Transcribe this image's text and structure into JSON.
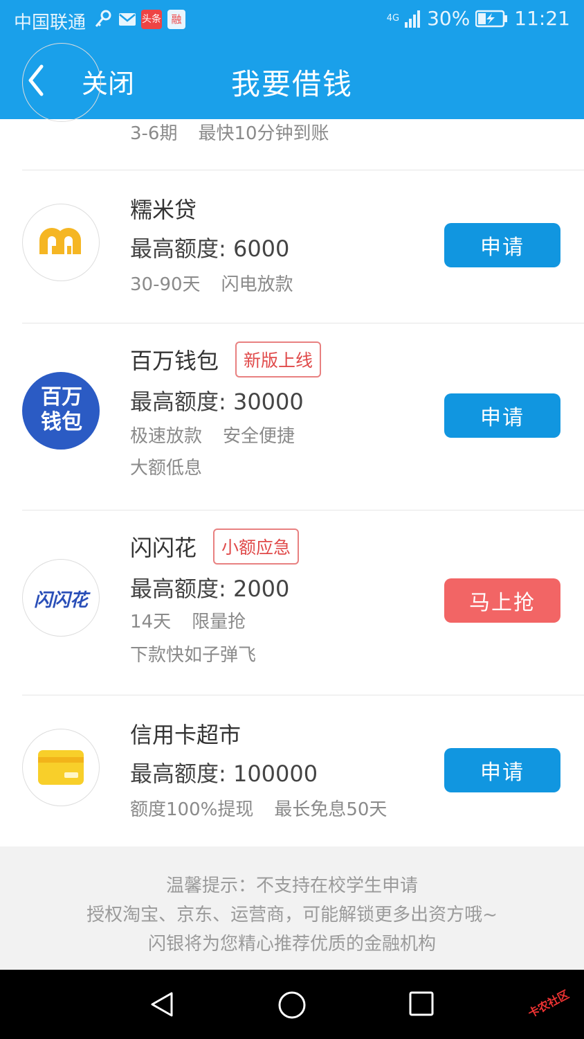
{
  "status_bar": {
    "carrier": "中国联通",
    "network": "4G",
    "battery": "30%",
    "time": "11:21",
    "icons": [
      "key-icon",
      "mail-icon",
      "toutiao-app-icon",
      "rong-app-icon",
      "signal-icon",
      "battery-charging-icon"
    ],
    "app_badges": {
      "toutiao": "头条",
      "rong": "融"
    }
  },
  "nav": {
    "close_label": "关闭",
    "title": "我要借钱"
  },
  "partial_item": {
    "desc": [
      "3-6期",
      "最快10分钟到账"
    ]
  },
  "items": [
    {
      "name": "糯米贷",
      "tag": "",
      "amount": "最高额度: 6000",
      "desc_line1": [
        "30-90天",
        "闪电放款"
      ],
      "desc_line2": "",
      "button": "申请",
      "button_color": "#1196e0",
      "logo": "nuomi-logo-icon"
    },
    {
      "name": "百万钱包",
      "tag": "新版上线",
      "amount": "最高额度: 30000",
      "desc_line1": [
        "极速放款",
        "安全便捷"
      ],
      "desc_line2": "大额低息",
      "button": "申请",
      "button_color": "#1196e0",
      "logo": "baiwan-wallet-logo-icon",
      "logo_text": [
        "百万",
        "钱包"
      ]
    },
    {
      "name": "闪闪花",
      "tag": "小额应急",
      "amount": "最高额度: 2000",
      "desc_line1": [
        "14天",
        "限量抢"
      ],
      "desc_line2": "下款快如子弹飞",
      "button": "马上抢",
      "button_color": "#f26565",
      "logo": "shanshanhua-logo-icon",
      "logo_text": "闪闪花"
    },
    {
      "name": "信用卡超市",
      "tag": "",
      "amount": "最高额度: 100000",
      "desc_line1": [
        "额度100%提现",
        "最长免息50天"
      ],
      "desc_line2": "",
      "button": "申请",
      "button_color": "#1196e0",
      "logo": "credit-card-icon"
    }
  ],
  "footer": {
    "line1": "温馨提示：不支持在校学生申请",
    "line2": "授权淘宝、京东、运营商，可能解锁更多出资方哦~",
    "line3": "闪银将为您精心推荐优质的金融机构"
  },
  "watermark": "卡农社区",
  "colors": {
    "primary": "#1aa0ea",
    "button_blue": "#1196e0",
    "button_red": "#f26565",
    "tag_red": "#e04a4a"
  }
}
